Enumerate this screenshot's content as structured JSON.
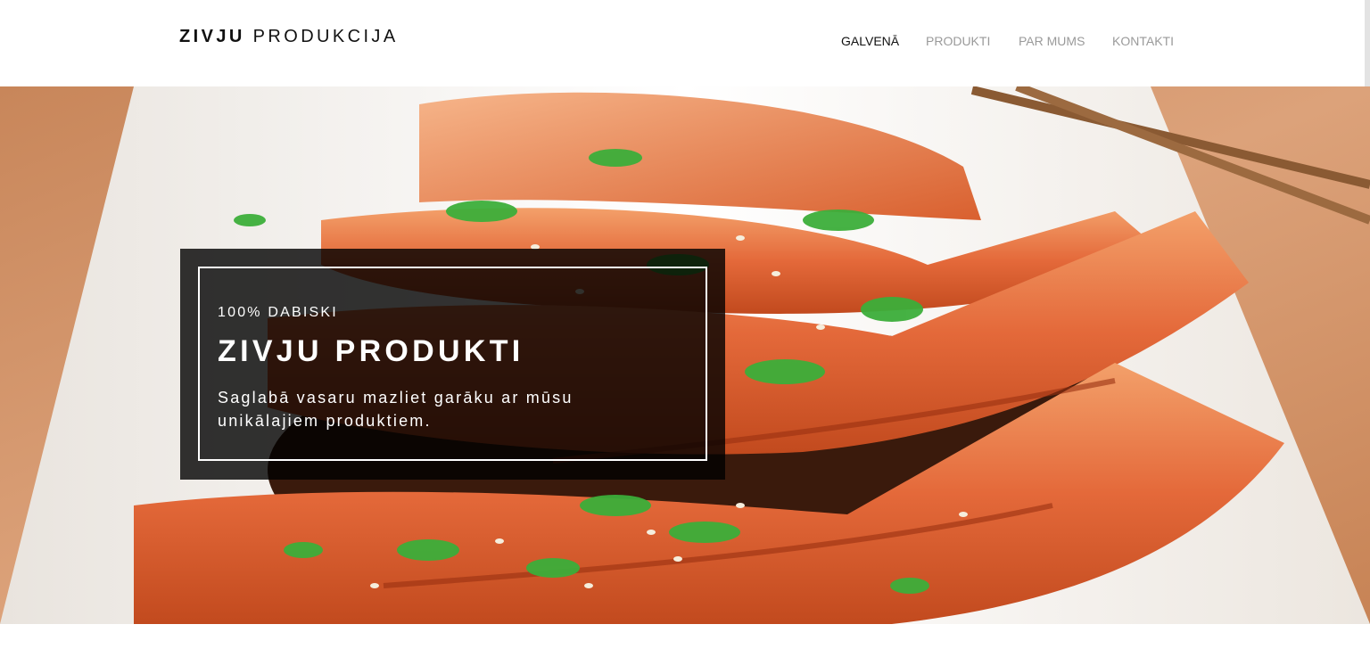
{
  "header": {
    "logo": {
      "bold": "ZIVJU",
      "light": "PRODUKCIJA"
    },
    "nav": [
      {
        "label": "GALVENĀ",
        "active": true
      },
      {
        "label": "PRODUKTI",
        "active": false
      },
      {
        "label": "PAR MUMS",
        "active": false
      },
      {
        "label": "KONTAKTI",
        "active": false
      }
    ]
  },
  "hero": {
    "image_subject": "grilled-salmon-with-sesame-and-green-onion",
    "eyebrow": "100% DABISKI",
    "headline": "ZIVJU PRODUKTI",
    "subtext": "Saglabā vasaru mazliet garāku ar mūsu unikālajiem produktiem."
  },
  "colors": {
    "header_bg": "#ffffff",
    "nav_active": "#111111",
    "nav_inactive": "#9a9a9a",
    "overlay_bg": "rgba(0,0,0,0.80)",
    "overlay_text": "#ffffff"
  }
}
